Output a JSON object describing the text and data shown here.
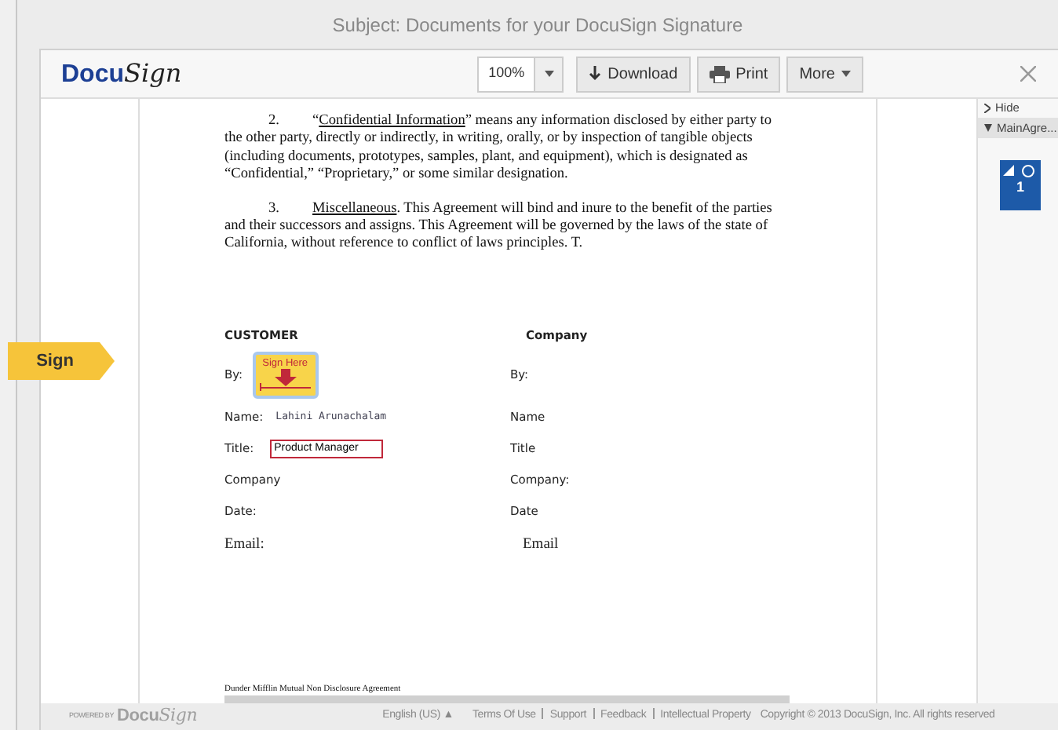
{
  "window": {
    "title": "Subject: Documents for your DocuSign Signature"
  },
  "toolbar": {
    "logo": "DocuSign",
    "zoom": "100%",
    "buttons": [
      {
        "kind": "download",
        "label": "Download"
      },
      {
        "kind": "print",
        "label": "Print"
      },
      {
        "kind": "more",
        "label": "More"
      }
    ]
  },
  "sign_tab": {
    "label": "Sign"
  },
  "document": {
    "paragraphs": [
      {
        "number": "2.",
        "term": "Confidential Information",
        "text_before": "“",
        "text_after": "” means any information disclosed by either party to the other party, directly or indirectly, in writing, orally, or by inspection of tangible objects (including documents, prototypes, samples, plant, and equipment), which is designated as “Confidential,” “Proprietary,” or some similar designation."
      },
      {
        "number": "3.",
        "term": "Miscellaneous",
        "text_after": ".  This Agreement will bind and inure to the benefit of the parties and their successors and assigns.  This Agreement will be governed by the laws of the state of California, without reference to conflict of laws principles.  T."
      }
    ],
    "columns": [
      {
        "heading": "CUSTOMER",
        "by": "By:",
        "sign_here": "Sign Here",
        "name_label": "Name:",
        "name_value": "Lahini Arunachalam",
        "title_label": "Title:",
        "title_value": "Product Manager",
        "company": "Company",
        "date": "Date:",
        "email": "Email:"
      },
      {
        "heading": "Company",
        "by": "By:",
        "name_label": "Name",
        "title_label": "Title",
        "company": "Company:",
        "date": "Date",
        "email": "Email"
      }
    ],
    "footer": "Dunder Mifflin Mutual Non Disclosure Agreement"
  },
  "side_panel": {
    "hide": "Hide",
    "document": "MainAgre...",
    "expanded": true,
    "page": "1"
  },
  "footer": {
    "powered_by": "POWERED BY",
    "logo": "DocuSign",
    "language": "English (US) ▲",
    "links": [
      "Terms Of Use",
      "Support",
      "Feedback",
      "Intellectual Property"
    ],
    "copyright": "Copyright © 2013 DocuSign, Inc. All rights reserved"
  }
}
